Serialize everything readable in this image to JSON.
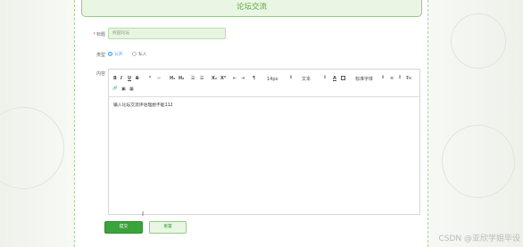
{
  "page": {
    "title": "论坛交流",
    "watermark": "CSDN @亚欣学姐毕设"
  },
  "form": {
    "title_label": "标题",
    "title_required_mark": "*",
    "title_value": "校园论坛",
    "type_label": "类型",
    "type_options": [
      {
        "label": "公开",
        "selected": true
      },
      {
        "label": "私人",
        "selected": false
      }
    ],
    "content_label": "内容",
    "content_value": "输入论坛交流评估理想不能112"
  },
  "editor_toolbar": {
    "bold": "B",
    "italic": "I",
    "underline": "U",
    "strike": "S",
    "quote": "❞",
    "code": "‹›",
    "h1": "H₁",
    "h2": "H₂",
    "ordered_list": "☰",
    "bullet_list": "☰",
    "subscript": "X₂",
    "superscript": "X²",
    "indent_left": "⇤",
    "indent_right": "⇥",
    "direction": "¶",
    "font_size": "14px",
    "paragraph": "文本",
    "color": "A",
    "font_family": "标准字体",
    "align": "≡",
    "clear": "T̶x",
    "link": "🔗",
    "image": "▣",
    "video": "▦"
  },
  "buttons": {
    "submit": "提交",
    "reset": "重置"
  },
  "colors": {
    "accent_green": "#3aa33a",
    "header_bg": "#eaf6e4",
    "radio_blue": "#409eff"
  }
}
